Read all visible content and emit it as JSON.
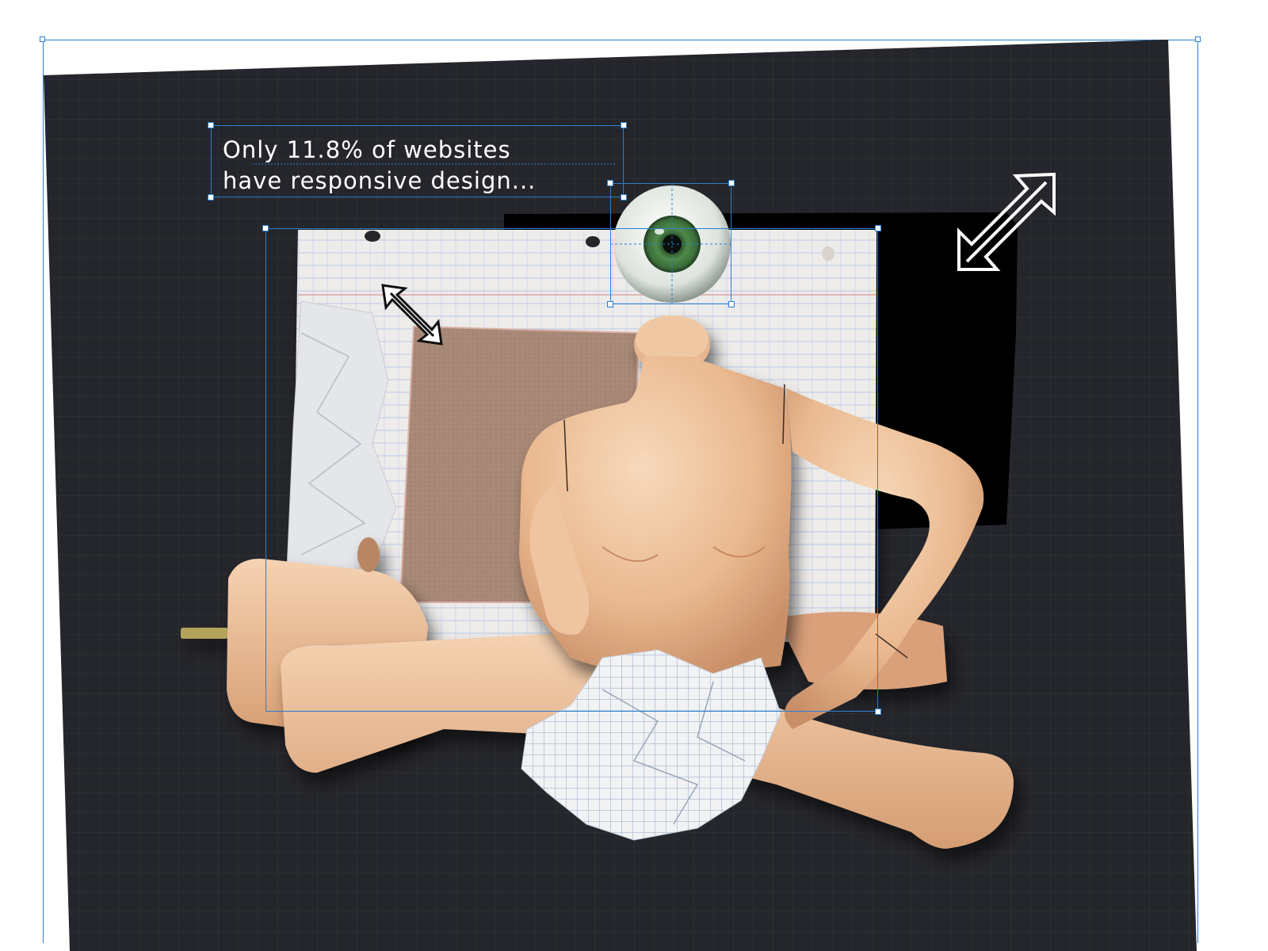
{
  "canvas": {
    "background_color": "#25262b",
    "grid_color": "#34363d",
    "selection_color": "#2a7fd0"
  },
  "caption": {
    "line1": "Only 11.8% of websites",
    "line2": "have  responsive design..."
  },
  "collage": {
    "elements": [
      "lined-notebook-paper",
      "crumpled-white-paper",
      "kraft-cardboard-sheet",
      "black-paper-sheet",
      "glass-eyeball",
      "headless-mannequin-torso",
      "mannequin-arm",
      "mannequin-legs",
      "detached-mannequin-leg",
      "crumpled-graph-paper"
    ]
  },
  "icons": {
    "small_arrow": "resize-diagonal-arrow-icon",
    "large_arrow": "resize-diagonal-arrow-icon"
  }
}
